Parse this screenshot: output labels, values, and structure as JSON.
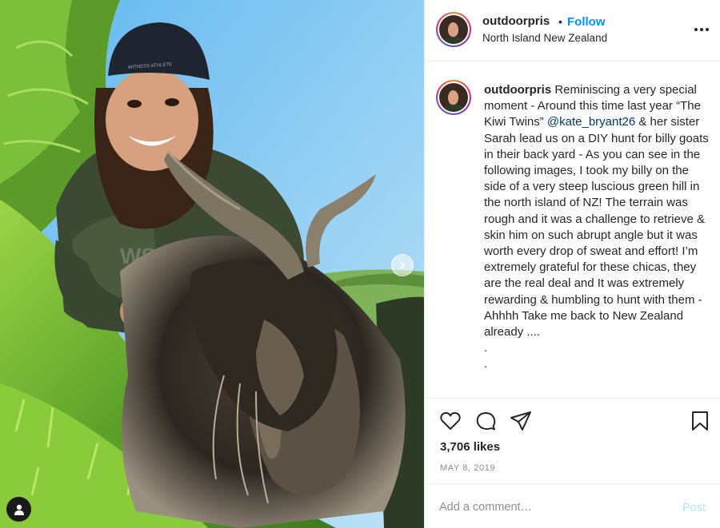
{
  "post": {
    "username": "outdoorpris",
    "dot": "•",
    "follow_label": "Follow",
    "location": "North Island New Zealand",
    "more_icon": "more-options-icon",
    "photo": {
      "description_icon": "photo",
      "cap_text": "WITNESS ATHLETE",
      "shirt_logo": "WS",
      "next_icon": "chevron-right-icon",
      "user_tag_icon": "user-tag-icon"
    },
    "caption": {
      "username": "outdoorpris",
      "part1": " Reminiscing a very special moment - Around this time last year “The Kiwi Twins” ",
      "mention": "@kate_bryant26",
      "part2": " & her sister Sarah lead us on a DIY hunt for billy goats in their back yard - As you can see in the following images, I took my billy on the side of a very steep luscious green hill in the north island of NZ! The terrain was rough and it was a challenge to retrieve & skin him on such abrupt angle but it was worth every drop of sweat and effort! I’m extremely grateful for these chicas, they are the real deal and It was extremely rewarding & humbling to hunt with them - Ahhhh Take me back to New Zealand already ....",
      "trail1": ".",
      "trail2": "."
    },
    "actions": {
      "like_icon": "heart-icon",
      "comment_icon": "comment-icon",
      "share_icon": "share-icon",
      "save_icon": "bookmark-icon"
    },
    "likes_text": "3,706 likes",
    "date": "MAY 8, 2019",
    "comment_placeholder": "Add a comment…",
    "post_label": "Post",
    "colors": {
      "accent": "#0095f6",
      "post_disabled": "#b2dffc",
      "mention": "#00376b",
      "muted": "#8e8e8e"
    }
  }
}
